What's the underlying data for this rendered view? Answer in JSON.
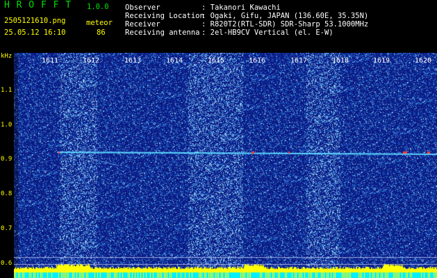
{
  "app": {
    "name": "H R O F F T",
    "version": "1.0.0"
  },
  "file": {
    "name": "2505121610.png",
    "datetime": "25.05.12 16:10"
  },
  "mode": {
    "label": "meteor",
    "count": "86"
  },
  "info": [
    {
      "key": "Observer",
      "value": ": Takanori Kawachi"
    },
    {
      "key": "Receiving Location",
      "value": ": Ogaki, Gifu, JAPAN (136.60E, 35.35N)"
    },
    {
      "key": "Receiver",
      "value": ": R820T2(RTL-SDR) SDR-Sharp 53.1000MHz"
    },
    {
      "key": "Receiving antenna",
      "value": ": 2el-HB9CV Vertical (el. E-W)"
    }
  ],
  "axes": {
    "y_unit": "kHz",
    "y_ticks": [
      "1.1",
      "1.0",
      "0.9",
      "0.8",
      "0.7",
      "0.6"
    ],
    "x_ticks": [
      "1611",
      "1612",
      "1613",
      "1614",
      "1615",
      "1616",
      "1617",
      "1618",
      "1619",
      "1620"
    ]
  },
  "colors": {
    "background": "#000000",
    "spectrum_bg": "#0a1a8a",
    "signal": "#4ad0ff",
    "hot": "#ff3030",
    "baseline": "#ffff00",
    "bottom_band": "#00ffff"
  }
}
